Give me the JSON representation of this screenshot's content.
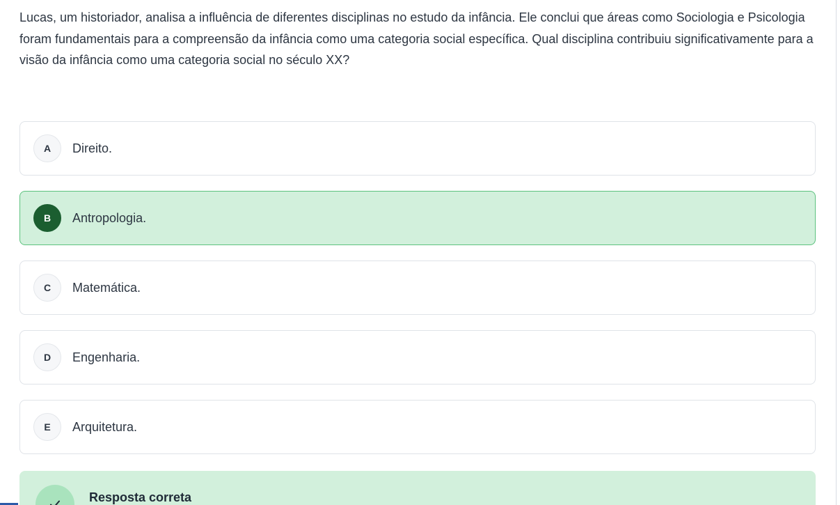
{
  "question": {
    "text": "Lucas, um historiador, analisa a influência de diferentes disciplinas no estudo da infância. Ele conclui que áreas como Sociologia e Psicologia foram fundamentais para a compreensão da infância como uma categoria social específica. Qual disciplina contribuiu significativamente para a visão da infância como uma categoria social no século XX?"
  },
  "options": [
    {
      "letter": "A",
      "label": "Direito.",
      "selected": false
    },
    {
      "letter": "B",
      "label": "Antropologia.",
      "selected": true
    },
    {
      "letter": "C",
      "label": "Matemática.",
      "selected": false
    },
    {
      "letter": "D",
      "label": "Engenharia.",
      "selected": false
    },
    {
      "letter": "E",
      "label": "Arquitetura.",
      "selected": false
    }
  ],
  "feedback": {
    "title": "Resposta correta",
    "icon": "check-icon"
  },
  "colors": {
    "selected_bg": "#d2f0dc",
    "selected_border": "#5cc27e",
    "selected_badge": "#1b5e30",
    "feedback_bg": "#d2f0dc",
    "feedback_icon_bg": "#a9e3bd"
  }
}
